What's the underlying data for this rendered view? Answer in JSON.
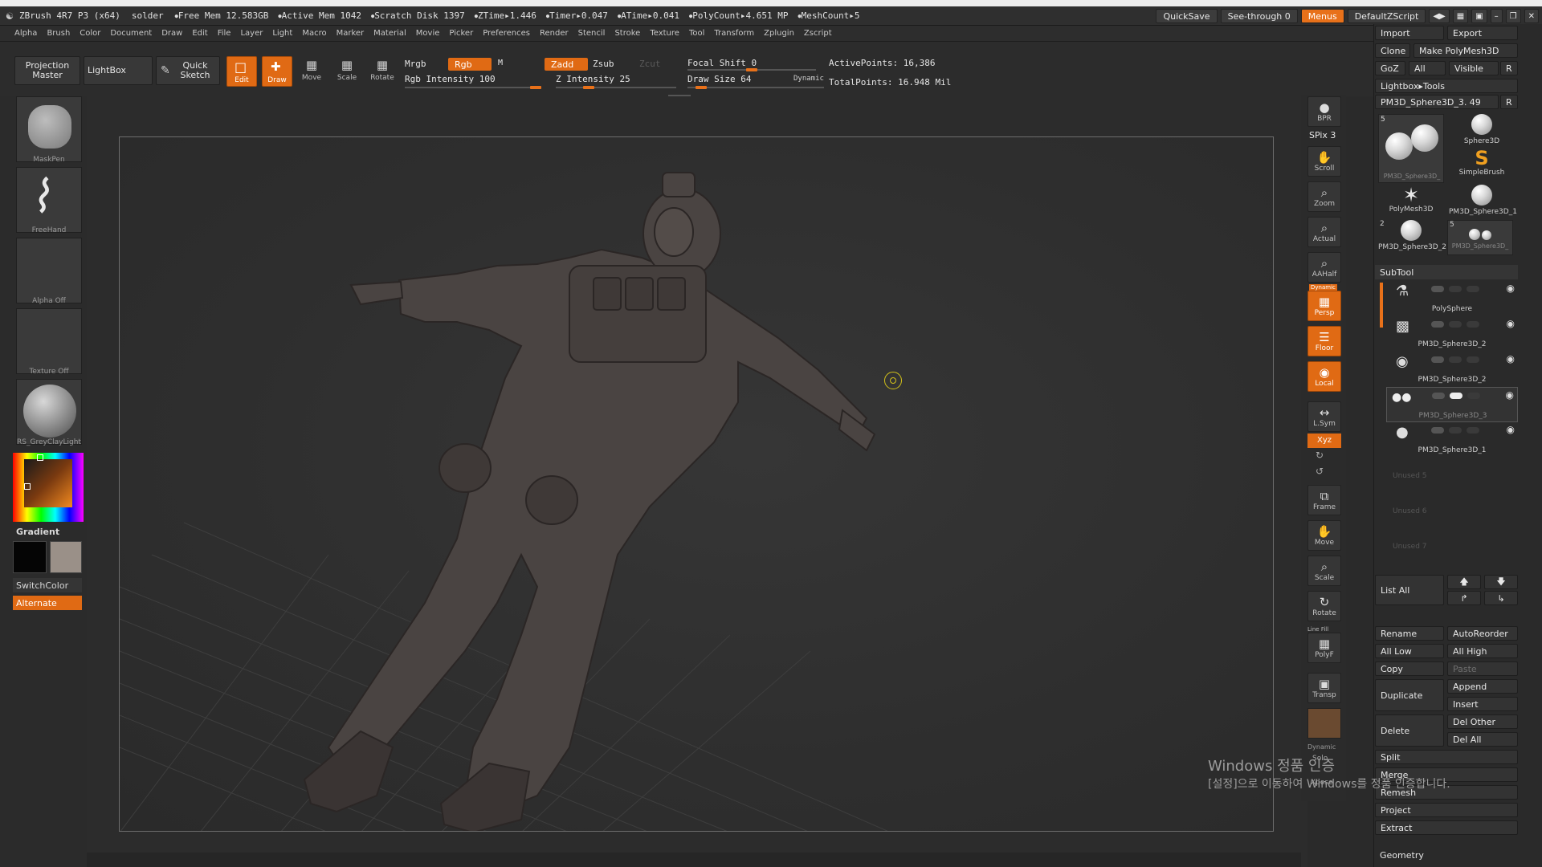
{
  "app": {
    "title": "ZBrush 4R7 P3 (x64)",
    "document": "solder",
    "stats": [
      "Free Mem 12.583GB",
      "Active Mem 1042",
      "Scratch Disk 1397",
      "ZTime▸1.446",
      "Timer▸0.047",
      "ATime▸0.041",
      "PolyCount▸4.651 MP",
      "MeshCount▸5"
    ]
  },
  "titlebar_right": {
    "quicksave": "QuickSave",
    "see_through": "See-through  0",
    "menus": "Menus",
    "script": "DefaultZScript"
  },
  "menu": [
    "Alpha",
    "Brush",
    "Color",
    "Document",
    "Draw",
    "Edit",
    "File",
    "Layer",
    "Light",
    "Macro",
    "Marker",
    "Material",
    "Movie",
    "Picker",
    "Preferences",
    "Render",
    "Stencil",
    "Stroke",
    "Texture",
    "Tool",
    "Transform",
    "Zplugin",
    "Zscript"
  ],
  "toolbar": {
    "projection_master": "Projection Master",
    "lightbox": "LightBox",
    "quick_sketch": "Quick Sketch",
    "edit": "Edit",
    "draw": "Draw",
    "move": "Move",
    "scale": "Scale",
    "rotate": "Rotate",
    "mrgb": "Mrgb",
    "rgb": "Rgb",
    "m": "M",
    "zadd": "Zadd",
    "zsub": "Zsub",
    "zcut": "Zcut",
    "rgb_intensity": "Rgb Intensity 100",
    "z_intensity": "Z Intensity 25",
    "focal_shift": "Focal Shift 0",
    "draw_size": "Draw Size 64",
    "dynamic": "Dynamic",
    "active_points": "ActivePoints: 16,386",
    "total_points": "TotalPoints: 16.948 Mil",
    "rgb_intensity_value": 100,
    "z_intensity_value": 25,
    "focal_shift_value": 0,
    "draw_size_value": 64
  },
  "left": {
    "brush": "MaskPen",
    "stroke": "FreeHand",
    "alpha": "Alpha Off",
    "texture": "Texture Off",
    "material": "RS_GreyClayLight",
    "gradient": "Gradient",
    "switch_color": "SwitchColor",
    "alternate": "Alternate"
  },
  "shelf": [
    {
      "label": "BPR",
      "icon": "bpr-icon",
      "glyph": "●",
      "orange": false
    },
    {
      "label": "Scroll",
      "icon": "scroll-icon",
      "glyph": "✋",
      "orange": false
    },
    {
      "label": "Zoom",
      "icon": "zoom-icon",
      "glyph": "⌕",
      "orange": false
    },
    {
      "label": "Actual",
      "icon": "actual-icon",
      "glyph": "⌕",
      "orange": false
    },
    {
      "label": "AAHalf",
      "icon": "aahalf-icon",
      "glyph": "⌕",
      "orange": false
    },
    {
      "label": "Persp",
      "icon": "persp-icon",
      "glyph": "▦",
      "orange": true
    },
    {
      "label": "Floor",
      "icon": "floor-icon",
      "glyph": "☰",
      "orange": true
    },
    {
      "label": "Local",
      "icon": "local-icon",
      "glyph": "◉",
      "orange": true
    },
    {
      "label": "L.Sym",
      "icon": "lsym-icon",
      "glyph": "↔",
      "orange": false
    },
    {
      "label": "Frame",
      "icon": "frame-icon",
      "glyph": "⧉",
      "orange": false
    },
    {
      "label": "Move",
      "icon": "move-icon",
      "glyph": "✋",
      "orange": false
    },
    {
      "label": "Scale",
      "icon": "scale-icon",
      "glyph": "⌕",
      "orange": false
    },
    {
      "label": "Rotate",
      "icon": "rotate-icon",
      "glyph": "↻",
      "orange": false
    },
    {
      "label": "PolyF",
      "icon": "polyf-icon",
      "glyph": "▦",
      "orange": false
    },
    {
      "label": "Transp",
      "icon": "transp-icon",
      "glyph": "▣",
      "orange": false
    }
  ],
  "shelf_extra": {
    "spix": "SPix 3",
    "xyz": "Xyz",
    "dynamic": "Dynamic",
    "solo": "Solo",
    "xpose": "Xpose",
    "line_fill": "Line Fill"
  },
  "tool_panel": {
    "import": "Import",
    "export": "Export",
    "clone": "Clone",
    "make_polymesh": "Make PolyMesh3D",
    "goz": "GoZ",
    "all": "All",
    "visible": "Visible",
    "r": "R",
    "lightbox_tools": "Lightbox▸Tools",
    "current_tool": "PM3D_Sphere3D_3. 49",
    "current_r": "R",
    "tools": [
      {
        "name": "PM3D_Sphere3D_",
        "count": "5"
      },
      {
        "name": "Sphere3D",
        "count": ""
      },
      {
        "name": "SimpleBrush",
        "count": ""
      },
      {
        "name": "PolyMesh3D",
        "count": ""
      },
      {
        "name": "PM3D_Sphere3D_1",
        "count": ""
      },
      {
        "name": "PM3D_Sphere3D_2",
        "count": "2"
      },
      {
        "name": "PM3D_Sphere3D_",
        "count": "5"
      }
    ],
    "subtool_header": "SubTool",
    "subtools": [
      "PolySphere",
      "PM3D_Sphere3D_2",
      "PM3D_Sphere3D_2",
      "PM3D_Sphere3D_3",
      "PM3D_Sphere3D_1"
    ],
    "unused": [
      "Unused 5",
      "Unused 6",
      "Unused 7"
    ],
    "list_all": "List  All",
    "rename": "Rename",
    "autoreorder": "AutoReorder",
    "all_low": "All Low",
    "all_high": "All High",
    "copy": "Copy",
    "paste": "Paste",
    "duplicate": "Duplicate",
    "append": "Append",
    "insert": "Insert",
    "delete": "Delete",
    "del_other": "Del Other",
    "del_all": "Del All",
    "split": "Split",
    "merge": "Merge",
    "remesh": "Remesh",
    "project": "Project",
    "extract": "Extract",
    "geometry": "Geometry"
  },
  "watermark": {
    "line1": "Windows 정품 인증",
    "line2": "[설정]으로 이동하여 Windows를 정품 인증합니다."
  },
  "colors": {
    "accent": "#e8711a",
    "panel": "#2b2b2b",
    "model": "#4a4442"
  }
}
